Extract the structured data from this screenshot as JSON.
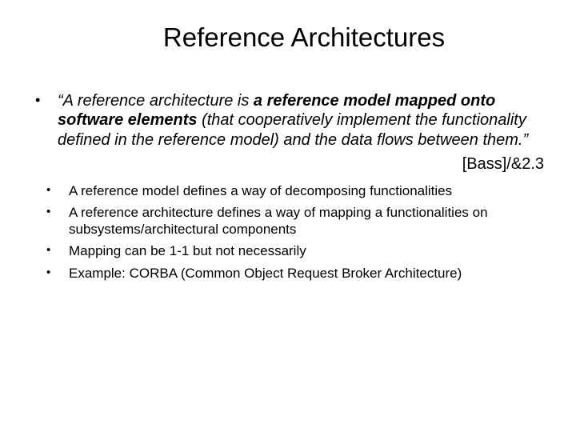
{
  "title": "Reference Architectures",
  "bullet1_pre": "“A reference architecture is ",
  "bullet1_bold": "a reference model mapped onto software elements",
  "bullet1_post": " (that cooperatively implement the functionality defined in the reference model) and the data flows between them.”",
  "citation": "[Bass]/&2.3",
  "bullet2": "A reference model defines a way of  decomposing functionalities",
  "bullet3": "A reference architecture defines a way of mapping a functionalities on subsystems/architectural components",
  "bullet4": "Mapping  can be 1-1 but not necessarily",
  "bullet5": "Example: CORBA (Common Object Request Broker Architecture)"
}
